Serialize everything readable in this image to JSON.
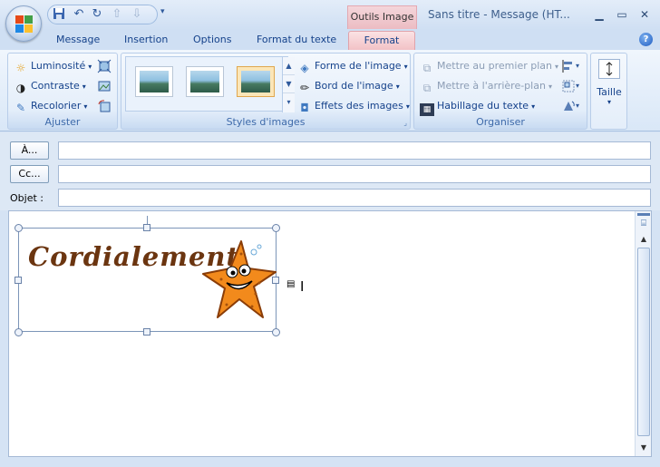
{
  "window": {
    "context_tab": "Outils Image",
    "title": "Sans titre  -  Message (HT..."
  },
  "tabs": [
    {
      "label": "Message"
    },
    {
      "label": "Insertion"
    },
    {
      "label": "Options"
    },
    {
      "label": "Format du texte"
    },
    {
      "label": "Format",
      "active": true
    }
  ],
  "ribbon": {
    "ajuster": {
      "label": "Ajuster",
      "luminosite": "Luminosité",
      "contraste": "Contraste",
      "recolorier": "Recolorier"
    },
    "styles": {
      "label": "Styles d'images",
      "forme": "Forme de l'image",
      "bord": "Bord de l'image",
      "effets": "Effets des images"
    },
    "organiser": {
      "label": "Organiser",
      "premier_plan": "Mettre au premier plan",
      "arriere_plan": "Mettre à l'arrière-plan",
      "habillage": "Habillage du texte"
    },
    "taille": {
      "label": "Taille"
    }
  },
  "header": {
    "to_button": "À...",
    "cc_button": "Cc...",
    "subject_label": "Objet :",
    "to_value": "",
    "cc_value": "",
    "subject_value": ""
  },
  "body": {
    "signature_text": "Cordialement,"
  },
  "colors": {
    "accent": "#15428b",
    "context_tab": "#ecbcc3",
    "signature": "#6b3510",
    "starfish": "#f28a1c"
  }
}
